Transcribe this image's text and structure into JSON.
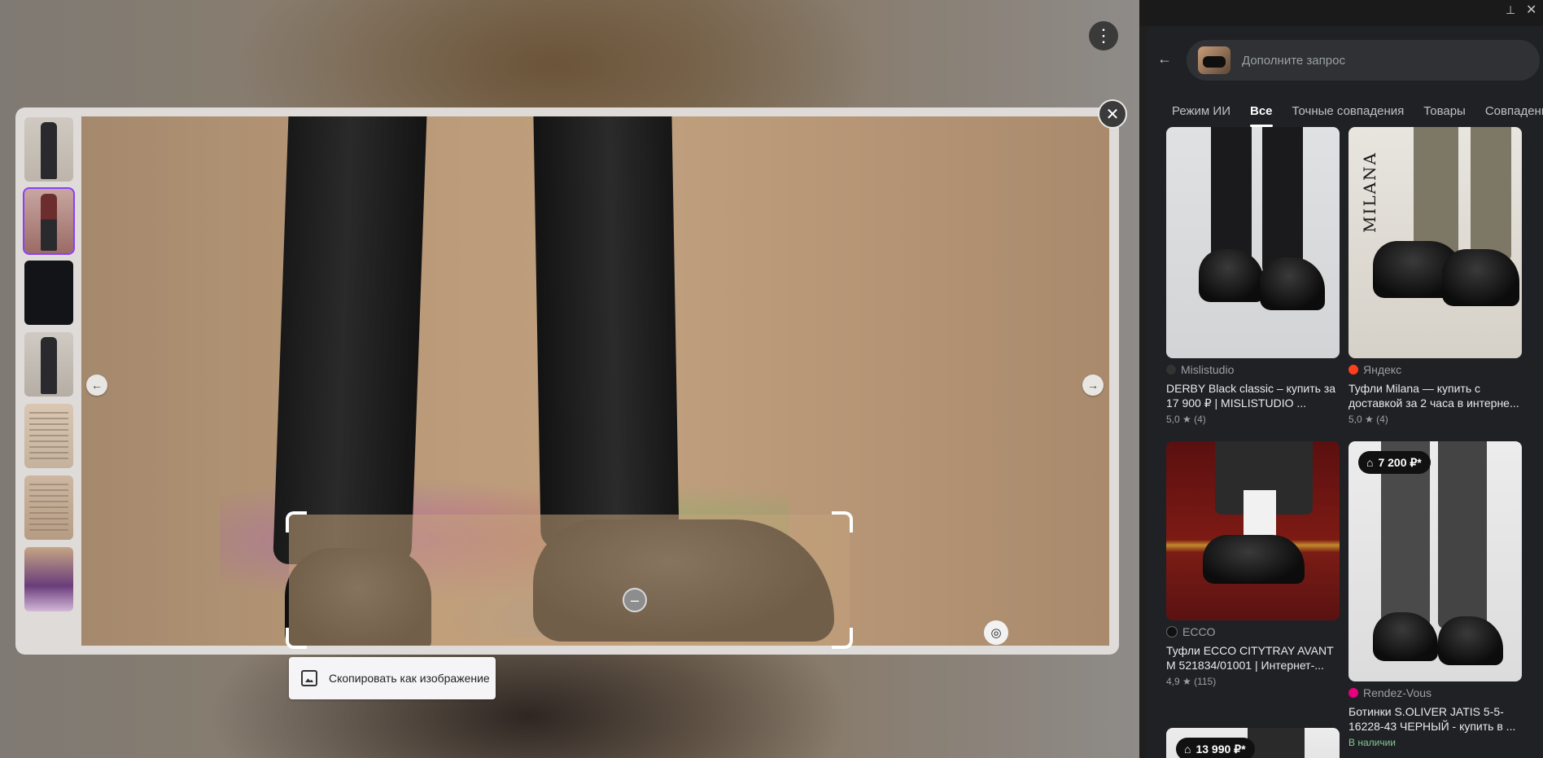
{
  "viewer": {
    "menu_icon": "more-vert-icon",
    "close_icon": "close-icon",
    "copy_button_label": "Скопировать как изображение",
    "thumbnails": [
      "thumb-1",
      "thumb-2",
      "thumb-3",
      "thumb-4",
      "thumb-5",
      "thumb-6",
      "thumb-7"
    ],
    "selected_thumbnail_index": 1
  },
  "panel": {
    "search_placeholder": "Дополните запрос",
    "tabs": [
      "Режим ИИ",
      "Все",
      "Точные совпадения",
      "Товары",
      "Совпадения"
    ],
    "active_tab": "Все",
    "results": [
      {
        "source": "Mislistudio",
        "title": "DERBY Black classic – купить за 17 900 ₽ | MISLISTUDIO ...",
        "rating": "5,0 ★ (4)"
      },
      {
        "source": "Яндекс",
        "title": "Туфли Milana — купить с доставкой за 2 часа в интерне...",
        "rating": "5,0 ★ (4)",
        "image_text": "MILANA"
      },
      {
        "source": "ECCO",
        "title": "Туфли ECCO CITYTRAY AVANT M 521834/01001 | Интернет-...",
        "rating": "4,9 ★ (115)"
      },
      {
        "source": "Rendez-Vous",
        "title": "Ботинки S.OLIVER JATIS 5-5-16228-43 ЧЕРНЫЙ - купить в ...",
        "price": "7 200 ₽*",
        "availability": "В наличии"
      },
      {
        "price": "13 990 ₽*"
      }
    ]
  },
  "colors": {
    "accent_selected_thumb": "#8a3ffc",
    "panel_bg": "#202124",
    "availability": "#81c995"
  }
}
